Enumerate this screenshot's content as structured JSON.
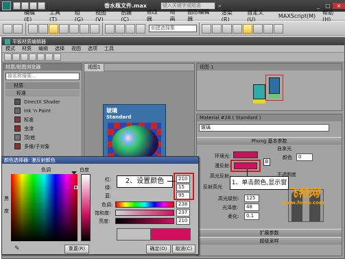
{
  "titlebar": {
    "title": "香水瓶文件.max",
    "search_placeholder": "键入关键字或短语",
    "buttons": {
      "min": "_",
      "max": "□",
      "close": "×"
    }
  },
  "menubar": [
    "编辑(E)",
    "工具(T)",
    "组(G)",
    "视图(V)",
    "创建(C)",
    "修改器",
    "动画",
    "图形编辑器",
    "渲染(R)",
    "自定义(U)",
    "MAXScript(M)",
    "帮助(H)"
  ],
  "toolbar": {
    "selection_set": "创建选择集",
    "view_dropdown": "视图"
  },
  "mat_editor": {
    "title": "平板材质编辑器",
    "menus": [
      "模式",
      "材质",
      "编辑",
      "选择",
      "视图",
      "选项",
      "工具"
    ],
    "browser_title": "材质/贴图浏览器",
    "search_placeholder": "按名称搜索...",
    "groups": {
      "materials": "材质",
      "standard": "标准"
    },
    "items": [
      "DirectX Shader",
      "Ink 'n Paint",
      "标准",
      "虫漆",
      "顶/底",
      "多维/子对象"
    ],
    "view_tab": "视图1",
    "view_label": "视图 1",
    "node": {
      "name": "玻璃",
      "type": "Standard"
    },
    "prop_title": "Material #26 ( Standard )",
    "mat_name": "玻璃",
    "phong_rollout": "Phong 基本参数",
    "self_illum": "自发光",
    "color_label": "颜色",
    "color_value": "0",
    "ambient": "环境光:",
    "diffuse": "漫反射:",
    "specular_label": "高光反射:",
    "opacity_label": "不透明度",
    "reflect_highlight": "反射高光",
    "spec_level_label": "高光级别:",
    "spec_level": "125",
    "gloss_label": "光泽度:",
    "gloss": "48",
    "soften_label": "柔化:",
    "soften": "0.1",
    "ext_params": "扩展参数",
    "supersample": "超级采样",
    "lock_letter": "B"
  },
  "color_picker": {
    "title": "颜色选择器: 漫反射颜色",
    "hue_label": "色调",
    "whiteness_label": "白度",
    "black_label": "黑",
    "degree_label": "度",
    "red_label": "红:",
    "green_label": "绿:",
    "blue_label": "蓝:",
    "hue2_label": "色调:",
    "sat_label": "饱和度:",
    "val_label": "亮度:",
    "red": "210",
    "green": "15",
    "blue": "95",
    "hue": "238",
    "sat": "237",
    "val": "210",
    "reset": "重置(R)",
    "ok": "确定(O)",
    "cancel": "取消(C)"
  },
  "callouts": {
    "step1": "1、单击颜色,显示窗",
    "step2": "2、设置颜色"
  },
  "watermark": {
    "text": "飞特网",
    "url": "www.fevte.com"
  },
  "colors": {
    "picked": "#d20f5f",
    "callout_border": "#d21a1a"
  }
}
